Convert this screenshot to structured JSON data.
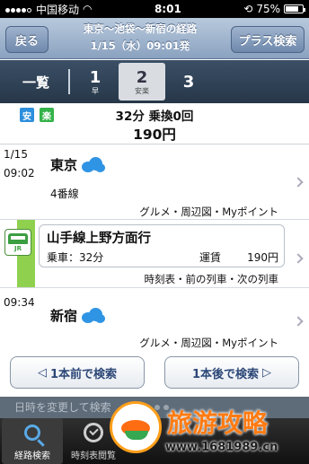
{
  "status": {
    "carrier": "中国移动",
    "time": "8:01",
    "battery": "75%",
    "battery_level": 0.75
  },
  "nav": {
    "back_label": "戻る",
    "title": "東京〜池袋〜新宿の経路",
    "subtitle": "1/15（水）09:01発",
    "plus_label": "プラス検索"
  },
  "tabs": {
    "list_label": "一覧",
    "routes": [
      {
        "num": "1",
        "sub": "早",
        "active": false
      },
      {
        "num": "2",
        "sub": "安楽",
        "active": true
      },
      {
        "num": "3",
        "sub": "",
        "active": false
      }
    ]
  },
  "summary": {
    "tag_safe": "安",
    "tag_easy": "楽",
    "duration_transfers": "32分 乗換0回",
    "fare": "190円"
  },
  "route": {
    "departure": {
      "date": "1/15",
      "time": "09:02",
      "station": "東京",
      "platform": "4番線",
      "links": "グルメ・周辺図・Myポイント",
      "weather_icon": "cloud-icon"
    },
    "train": {
      "name": "山手線上野方面行",
      "ride_label": "乗車：32分",
      "fare_label": "運賃",
      "fare": "190円",
      "links": "時刻表・前の列車・次の列車",
      "line_color": "#8fd14f",
      "icon_text": "JR"
    },
    "arrival": {
      "time": "09:34",
      "station": "新宿",
      "links": "グルメ・周辺図・Myポイント",
      "weather_icon": "cloud-icon"
    }
  },
  "actions": {
    "prev_label": "1本前で検索",
    "next_label": "1本後で検索",
    "prev_arrow": "◁",
    "next_arrow": "▷"
  },
  "strip": {
    "partial_text": "日時を変更して検索"
  },
  "tabbar": {
    "search_label": "経路検索",
    "timetable_label": "時刻表閲覧"
  },
  "watermark": {
    "title": "旅游攻略",
    "url": "www.1681989.cn"
  },
  "colors": {
    "accent_blue": "#2c4777",
    "nav_top": "#b8c9dc",
    "jr_green": "#3b9e41"
  }
}
